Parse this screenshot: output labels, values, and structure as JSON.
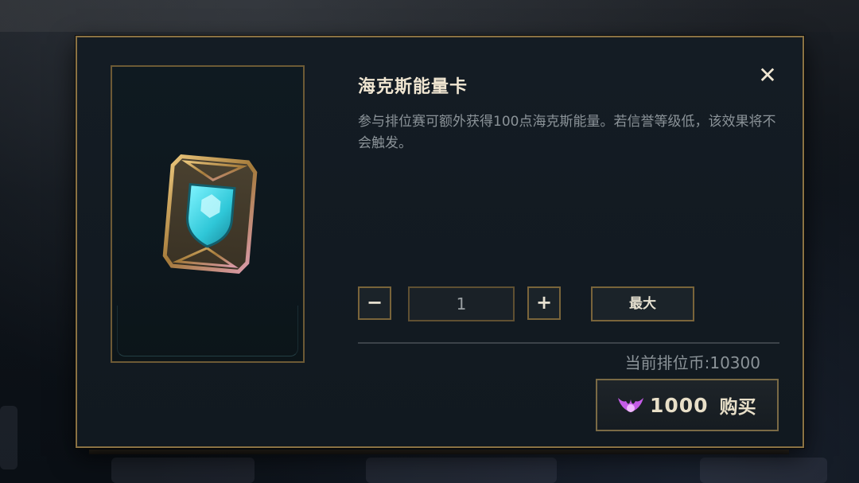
{
  "item": {
    "title": "海克斯能量卡",
    "description": "参与排位赛可额外获得100点海克斯能量。若信誉等级低，该效果将不会触发。",
    "image_icon": "hextech-energy-card"
  },
  "quantity": {
    "decrement_icon": "minus-icon",
    "decrement_label": "−",
    "value": "1",
    "increment_icon": "plus-icon",
    "increment_label": "+",
    "max_label": "最大"
  },
  "balance": {
    "text": "当前排位币:10300"
  },
  "purchase": {
    "currency_icon": "ranked-token-icon",
    "price": "1000",
    "label": "购买"
  },
  "close": {
    "icon": "close-icon",
    "label": "✕"
  },
  "colors": {
    "frame_gold": "#8a7243",
    "panel_bg": "#131b22",
    "title_text": "#f0e6d2",
    "body_text": "#8b9398",
    "token_purple": "#c55ce8",
    "shield_cyan": "#3fd8e6"
  }
}
